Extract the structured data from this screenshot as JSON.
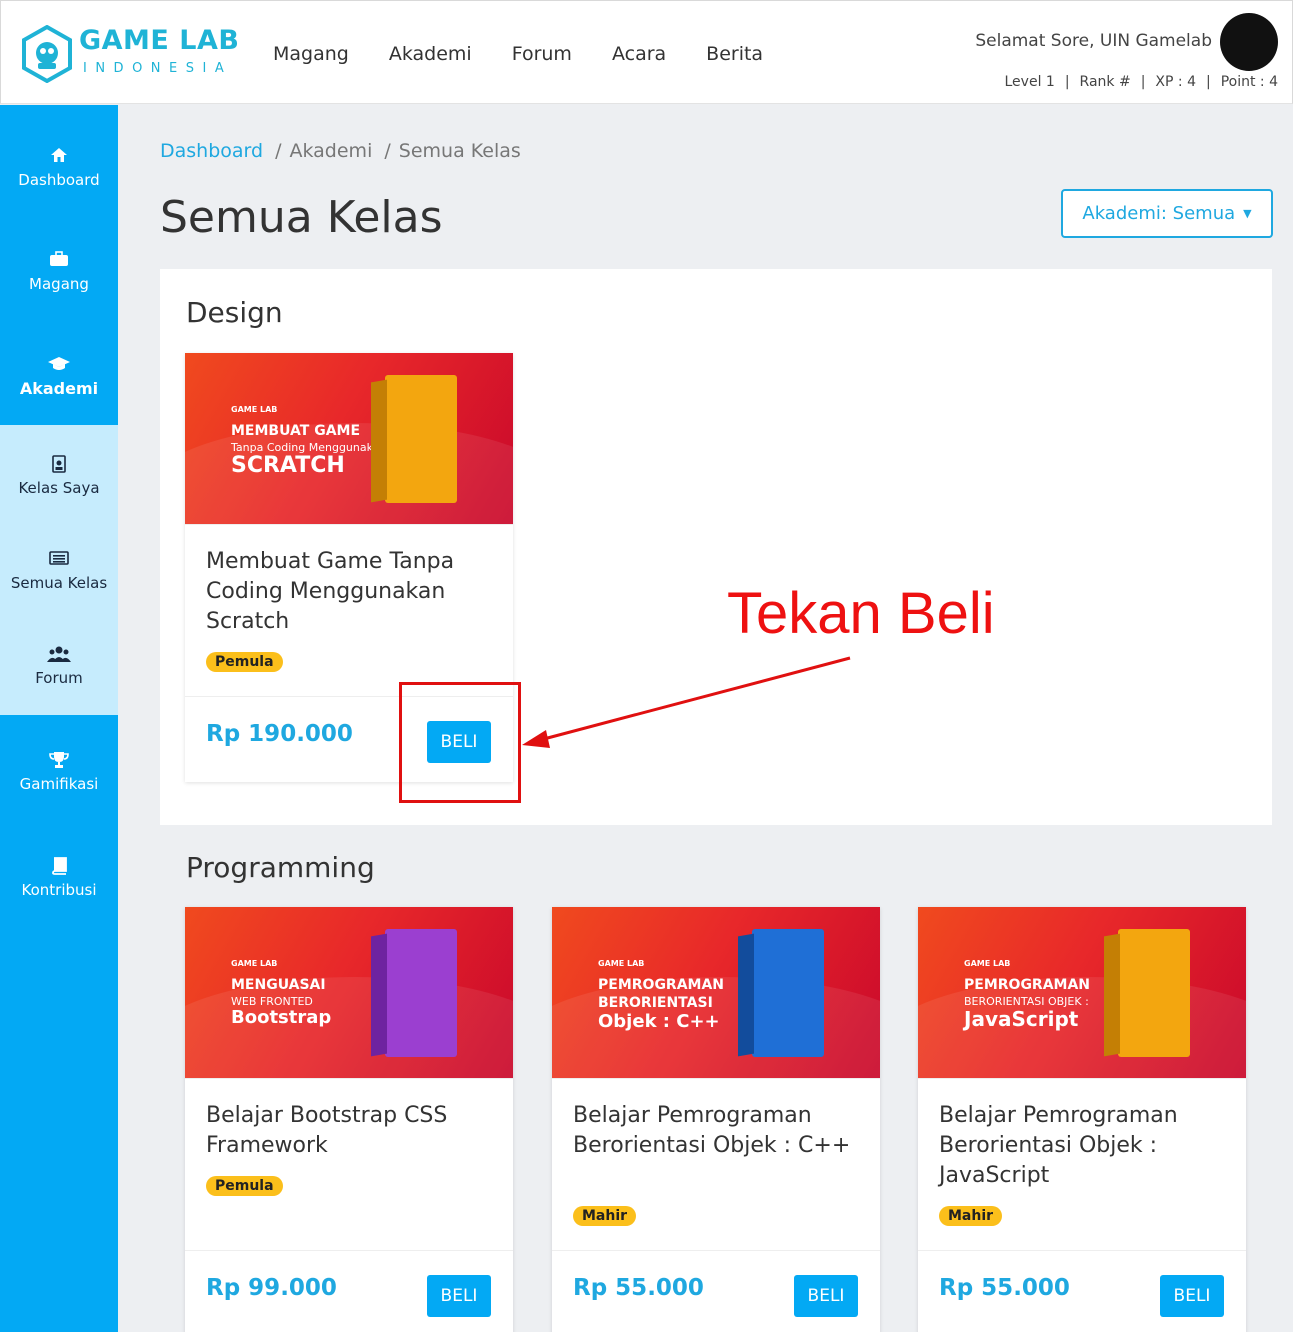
{
  "logo": {
    "title": "GAME LAB",
    "subtitle": "INDONESIA"
  },
  "topnav": [
    "Magang",
    "Akademi",
    "Forum",
    "Acara",
    "Berita"
  ],
  "user": {
    "greeting": "Selamat Sore, UIN Gamelab",
    "level": "Level 1",
    "rank": "Rank #",
    "xp": "XP : 4",
    "point": "Point : 4"
  },
  "sidebar": {
    "items": [
      {
        "label": "Dashboard",
        "icon": "home-icon"
      },
      {
        "label": "Magang",
        "icon": "briefcase-icon"
      },
      {
        "label": "Akademi",
        "icon": "graduation-cap-icon"
      },
      {
        "label": "Kelas Saya",
        "icon": "id-badge-icon"
      },
      {
        "label": "Semua Kelas",
        "icon": "list-icon"
      },
      {
        "label": "Forum",
        "icon": "users-icon"
      },
      {
        "label": "Gamifikasi",
        "icon": "trophy-icon"
      },
      {
        "label": "Kontribusi",
        "icon": "book-icon"
      }
    ]
  },
  "breadcrumb": {
    "home": "Dashboard",
    "section": "Akademi",
    "current": "Semua Kelas"
  },
  "page_title": "Semua Kelas",
  "filter": {
    "label": "Akademi: Semua"
  },
  "sections": [
    {
      "title": "Design",
      "courses": [
        {
          "banner_brand": "GAME LAB",
          "banner_line1": "MEMBUAT GAME",
          "banner_line2": "Tanpa Coding Menggunakan",
          "banner_line3": "SCRATCH",
          "name": "Membuat Game Tanpa Coding Menggunakan Scratch",
          "level": "Pemula",
          "price": "Rp 190.000",
          "button": "BELI",
          "box_color": "#f3a60f"
        }
      ]
    },
    {
      "title": "Programming",
      "courses": [
        {
          "banner_brand": "GAME LAB",
          "banner_line1": "MENGUASAI",
          "banner_line2": "WEB FRONTED",
          "banner_line3": "Bootstrap",
          "name": "Belajar Bootstrap CSS Framework",
          "level": "Pemula",
          "price": "Rp 99.000",
          "button": "BELI",
          "box_color": "#9b3fd0"
        },
        {
          "banner_brand": "GAME LAB",
          "banner_line1": "PEMROGRAMAN",
          "banner_line2": "BERORIENTASI",
          "banner_line3": "Objek : C++",
          "name": "Belajar Pemrograman Berorientasi Objek : C++",
          "level": "Mahir",
          "price": "Rp 55.000",
          "button": "BELI",
          "box_color": "#1f6fd6"
        },
        {
          "banner_brand": "GAME LAB",
          "banner_line1": "PEMROGRAMAN",
          "banner_line2": "BERORIENTASI OBJEK :",
          "banner_line3": "JavaScript",
          "name": "Belajar Pemrograman Berorientasi Objek : JavaScript",
          "level": "Mahir",
          "price": "Rp 55.000",
          "button": "BELI",
          "box_color": "#f3a60f"
        }
      ]
    }
  ],
  "annotation": {
    "text": "Tekan Beli"
  },
  "colors": {
    "primary": "#03a9f4",
    "link": "#1fa8e0",
    "badge": "#fbbf1b",
    "annotation": "#ee1111"
  }
}
